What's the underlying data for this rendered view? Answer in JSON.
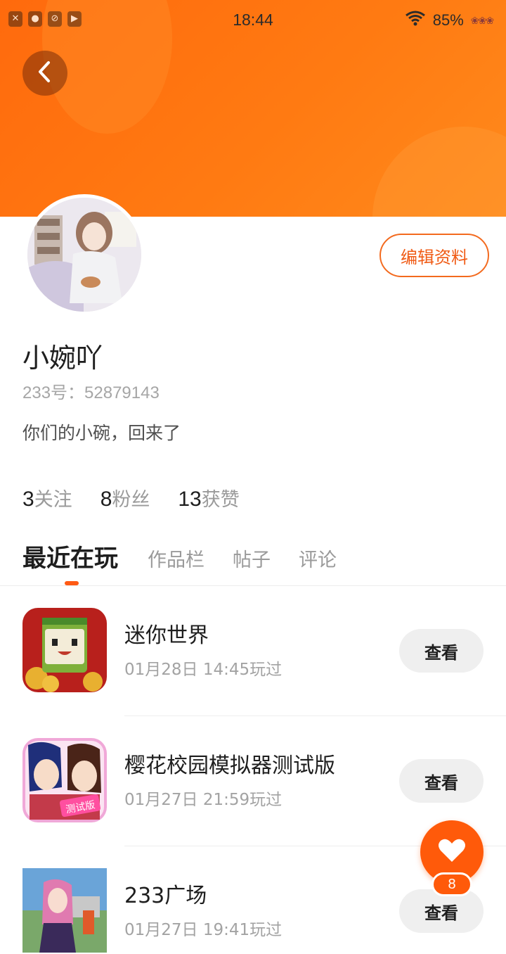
{
  "status_bar": {
    "time": "18:44",
    "battery": "85%",
    "left_icons": [
      "close-icon",
      "chat-icon",
      "camera-off-icon",
      "play-icon"
    ],
    "wifi_icon": "wifi-icon",
    "battery_icon": "battery-icon"
  },
  "header": {
    "back_icon": "chevron-left-icon",
    "accent_color": "#ff6a0d"
  },
  "profile": {
    "edit_label": "编辑资料",
    "nickname": "小婉吖",
    "uid_text": "233号：52879143",
    "bio": "你们的小碗，回来了",
    "stats": [
      {
        "num": "3",
        "label": "关注"
      },
      {
        "num": "8",
        "label": "粉丝"
      },
      {
        "num": "13",
        "label": "获赞"
      }
    ]
  },
  "tabs": [
    {
      "label": "最近在玩",
      "active": true
    },
    {
      "label": "作品栏",
      "active": false
    },
    {
      "label": "帖子",
      "active": false
    },
    {
      "label": "评论",
      "active": false
    }
  ],
  "games": [
    {
      "title": "迷你世界",
      "time": "01月28日 14:45玩过",
      "button": "查看",
      "icon": "mini-world-icon"
    },
    {
      "title": "樱花校园模拟器测试版",
      "time": "01月27日 21:59玩过",
      "button": "查看",
      "icon": "sakura-school-icon"
    },
    {
      "title": "233广场",
      "time": "01月27日 19:41玩过",
      "button": "查看",
      "icon": "233-plaza-icon"
    }
  ],
  "like_fab": {
    "icon": "heart-icon",
    "count": "8"
  }
}
